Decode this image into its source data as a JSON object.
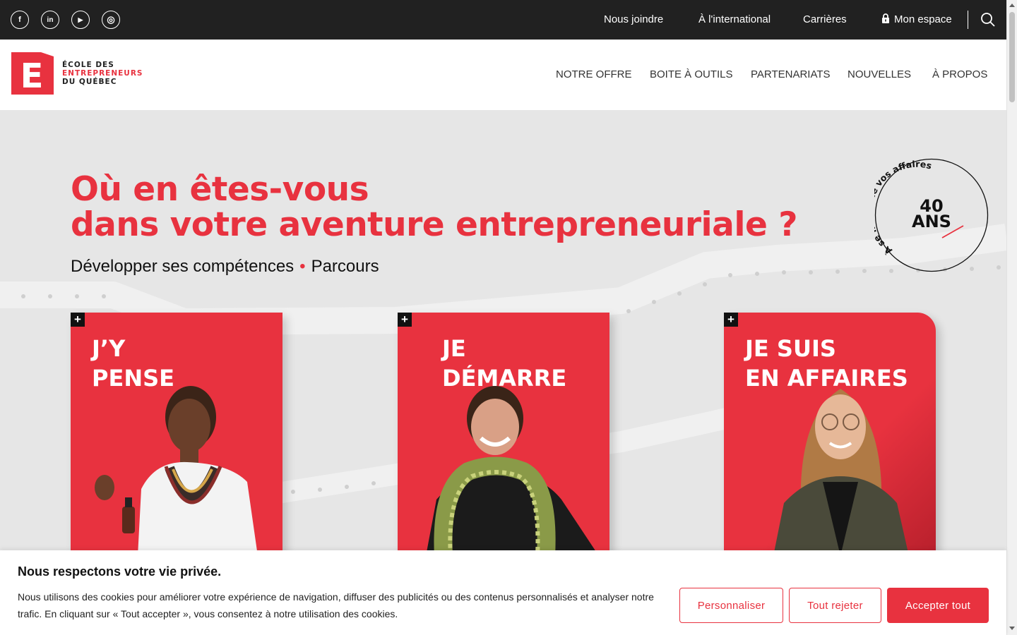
{
  "topbar": {
    "social": [
      {
        "name": "facebook-icon",
        "glyph": "f"
      },
      {
        "name": "linkedin-icon",
        "glyph": "in"
      },
      {
        "name": "youtube-icon",
        "glyph": "▶"
      },
      {
        "name": "instagram-icon",
        "glyph": "◎"
      }
    ],
    "links": {
      "contact": "Nous joindre",
      "international": "À l'international",
      "careers": "Carrières",
      "account": "Mon espace"
    }
  },
  "header": {
    "logo": {
      "line1": "ÉCOLE DES",
      "line2": "ENTREPRENEURS",
      "line3": "DU QUÉBEC",
      "mark": "E"
    },
    "nav": {
      "offer": "NOTRE OFFRE",
      "tools": "BOITE À OUTILS",
      "partners": "PARTENARIATS",
      "news": "NOUVELLES",
      "about": "À PROPOS"
    }
  },
  "hero": {
    "title_line1": "Où en êtes-vous",
    "title_line2": "dans votre aventure entrepreneuriale ?",
    "sub_left": "Développer ses compétences",
    "sub_sep": "•",
    "sub_right": "Parcours",
    "badge": {
      "arc_text": "À se mêler de vos affaires",
      "number": "40",
      "unit": "ANS"
    },
    "cards": [
      {
        "title": "J’Y\nPENSE",
        "plus": "+"
      },
      {
        "title": "JE\nDÉMARRE",
        "plus": "+"
      },
      {
        "title": "JE SUIS\nEN AFFAIRES",
        "plus": "+"
      }
    ]
  },
  "cookie": {
    "title": "Nous respectons votre vie privée.",
    "text": "Nous utilisons des cookies pour améliorer votre expérience de navigation, diffuser des publicités ou des contenus personnalisés et analyser notre trafic. En cliquant sur « Tout accepter », vous consentez à notre utilisation des cookies.",
    "customize": "Personnaliser",
    "reject": "Tout rejeter",
    "accept": "Accepter tout"
  },
  "colors": {
    "brand_red": "#e8323f",
    "topbar": "#212121",
    "hero_bg": "#e6e6e6"
  }
}
